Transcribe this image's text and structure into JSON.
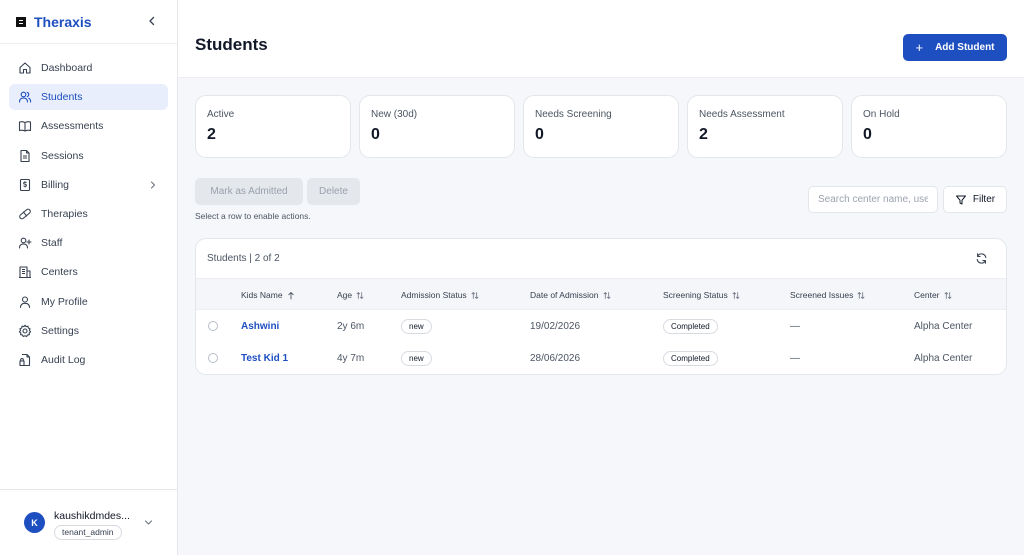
{
  "app": {
    "name": "Theraxis"
  },
  "sidebar": {
    "items": [
      {
        "label": "Dashboard",
        "icon": "home-icon"
      },
      {
        "label": "Students",
        "icon": "users-icon",
        "active": true
      },
      {
        "label": "Assessments",
        "icon": "book-icon"
      },
      {
        "label": "Sessions",
        "icon": "file-text-icon"
      },
      {
        "label": "Billing",
        "icon": "receipt-icon",
        "has_children": true
      },
      {
        "label": "Therapies",
        "icon": "pill-icon"
      },
      {
        "label": "Staff",
        "icon": "user-plus-icon"
      },
      {
        "label": "Centers",
        "icon": "building-icon"
      },
      {
        "label": "My Profile",
        "icon": "user-icon"
      },
      {
        "label": "Settings",
        "icon": "gear-icon"
      },
      {
        "label": "Audit Log",
        "icon": "file-audit-icon"
      }
    ]
  },
  "user": {
    "initial": "K",
    "name": "kaushikdmdes...",
    "role": "tenant_admin"
  },
  "header": {
    "title": "Students",
    "add_button_label": "Add Student"
  },
  "stats": [
    {
      "label": "Active",
      "value": "2"
    },
    {
      "label": "New (30d)",
      "value": "0"
    },
    {
      "label": "Needs Screening",
      "value": "0"
    },
    {
      "label": "Needs Assessment",
      "value": "2"
    },
    {
      "label": "On Hold",
      "value": "0"
    }
  ],
  "actions": {
    "mark_admitted_label": "Mark as Admitted",
    "delete_label": "Delete",
    "hint": "Select a row to enable actions.",
    "search_placeholder": "Search center name, user",
    "filter_label": "Filter"
  },
  "table": {
    "caption": "Students | 2 of 2",
    "columns": {
      "name": "Kids Name",
      "age": "Age",
      "admission_status": "Admission Status",
      "date_of_admission": "Date of Admission",
      "screening_status": "Screening Status",
      "screened_issues": "Screened Issues",
      "center": "Center"
    },
    "rows": [
      {
        "name": "Ashwini",
        "age": "2y 6m",
        "admission_status": "new",
        "date_of_admission": "19/02/2026",
        "screening_status": "Completed",
        "screened_issues": "—",
        "center": "Alpha Center"
      },
      {
        "name": "Test Kid 1",
        "age": "4y 7m",
        "admission_status": "new",
        "date_of_admission": "28/06/2026",
        "screening_status": "Completed",
        "screened_issues": "—",
        "center": "Alpha Center"
      }
    ]
  },
  "colors": {
    "primary": "#1e4fc1",
    "active_bg": "#e8eefb",
    "page_bg": "#f5f7fa"
  }
}
